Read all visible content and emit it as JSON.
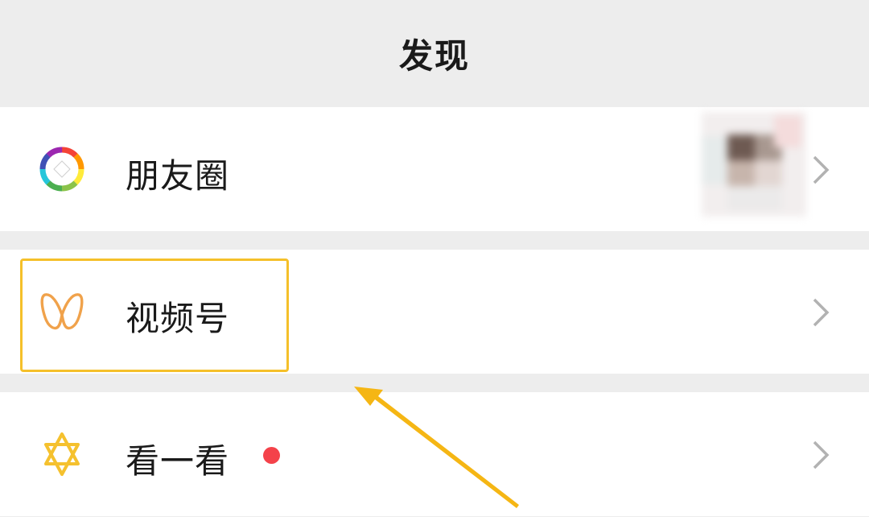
{
  "header": {
    "title": "发现"
  },
  "rows": [
    {
      "label": "朋友圈",
      "icon": "moments-icon"
    },
    {
      "label": "视频号",
      "icon": "channels-icon"
    },
    {
      "label": "看一看",
      "icon": "top-stories-icon"
    }
  ],
  "colors": {
    "background": "#ededed",
    "row_background": "#ffffff",
    "highlight": "#f5c02a",
    "badge": "#f4424a",
    "chevron": "#b2b2b2"
  }
}
